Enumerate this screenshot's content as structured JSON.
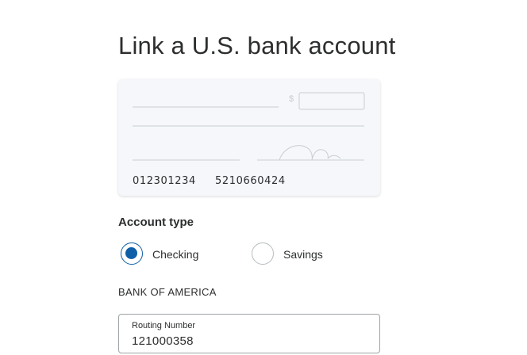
{
  "page": {
    "title": "Link a U.S. bank account"
  },
  "check": {
    "dollar_sign": "$",
    "routing_number": "012301234",
    "account_number": "5210660424"
  },
  "account_type": {
    "label": "Account type",
    "options": [
      {
        "label": "Checking",
        "selected": true
      },
      {
        "label": "Savings",
        "selected": false
      }
    ]
  },
  "bank": {
    "name": "BANK OF AMERICA"
  },
  "routing_field": {
    "label": "Routing Number",
    "value": "121000358"
  },
  "colors": {
    "accent": "#0e5fa8",
    "text": "#2c2e2f",
    "check_background": "#f5f7fa"
  }
}
